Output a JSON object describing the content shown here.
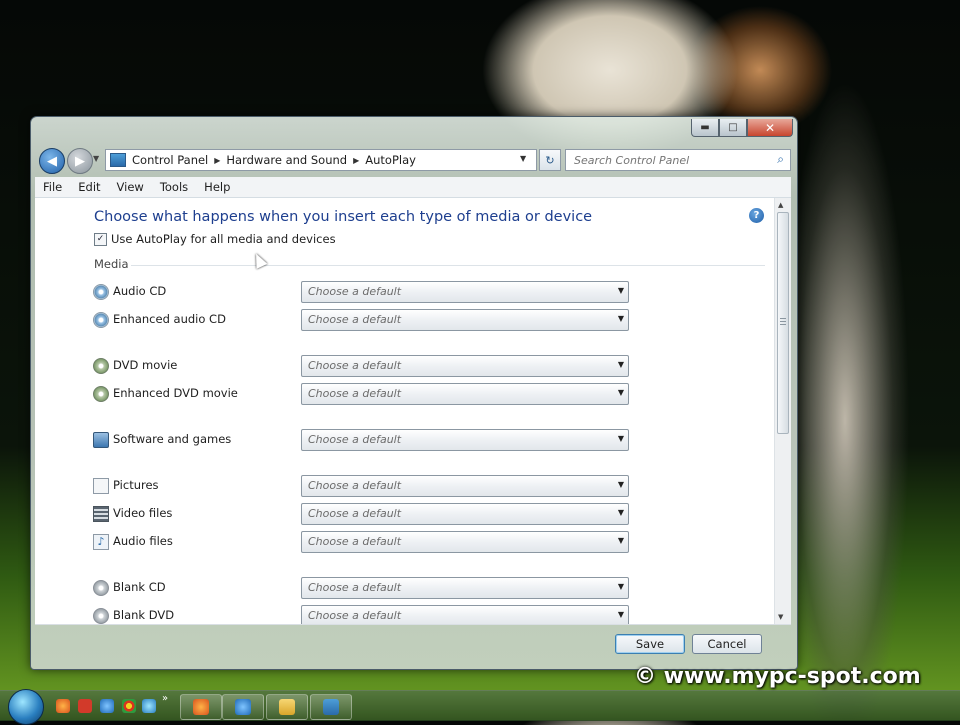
{
  "window": {
    "caption_buttons": {
      "minimize": "▬",
      "maximize": "□",
      "close": "✕"
    }
  },
  "navigation": {
    "back_glyph": "◀",
    "forward_glyph": "▶",
    "breadcrumb": [
      "Control Panel",
      "Hardware and Sound",
      "AutoPlay"
    ],
    "search_placeholder": "Search Control Panel"
  },
  "menu": [
    "File",
    "Edit",
    "View",
    "Tools",
    "Help"
  ],
  "content": {
    "heading": "Choose what happens when you insert each type of media or device",
    "use_autoplay_label": "Use AutoPlay for all media and devices",
    "use_autoplay_checked": true,
    "section_label": "Media",
    "select_placeholder": "Choose a default",
    "rows": [
      {
        "label": "Audio CD",
        "icon": "audio-cd-icon"
      },
      {
        "label": "Enhanced audio CD",
        "icon": "enhanced-audio-cd-icon"
      },
      {
        "label": "DVD movie",
        "icon": "dvd-movie-icon"
      },
      {
        "label": "Enhanced DVD movie",
        "icon": "enhanced-dvd-movie-icon"
      },
      {
        "label": "Software and games",
        "icon": "software-games-icon"
      },
      {
        "label": "Pictures",
        "icon": "pictures-icon"
      },
      {
        "label": "Video files",
        "icon": "video-files-icon"
      },
      {
        "label": "Audio files",
        "icon": "audio-files-icon"
      },
      {
        "label": "Blank CD",
        "icon": "blank-cd-icon"
      },
      {
        "label": "Blank DVD",
        "icon": "blank-dvd-icon"
      }
    ]
  },
  "footer": {
    "save": "Save",
    "cancel": "Cancel"
  },
  "watermark": "© www.mypc-spot.com",
  "colors": {
    "heading": "#1e3f8f",
    "accent": "#2a6aa9"
  }
}
